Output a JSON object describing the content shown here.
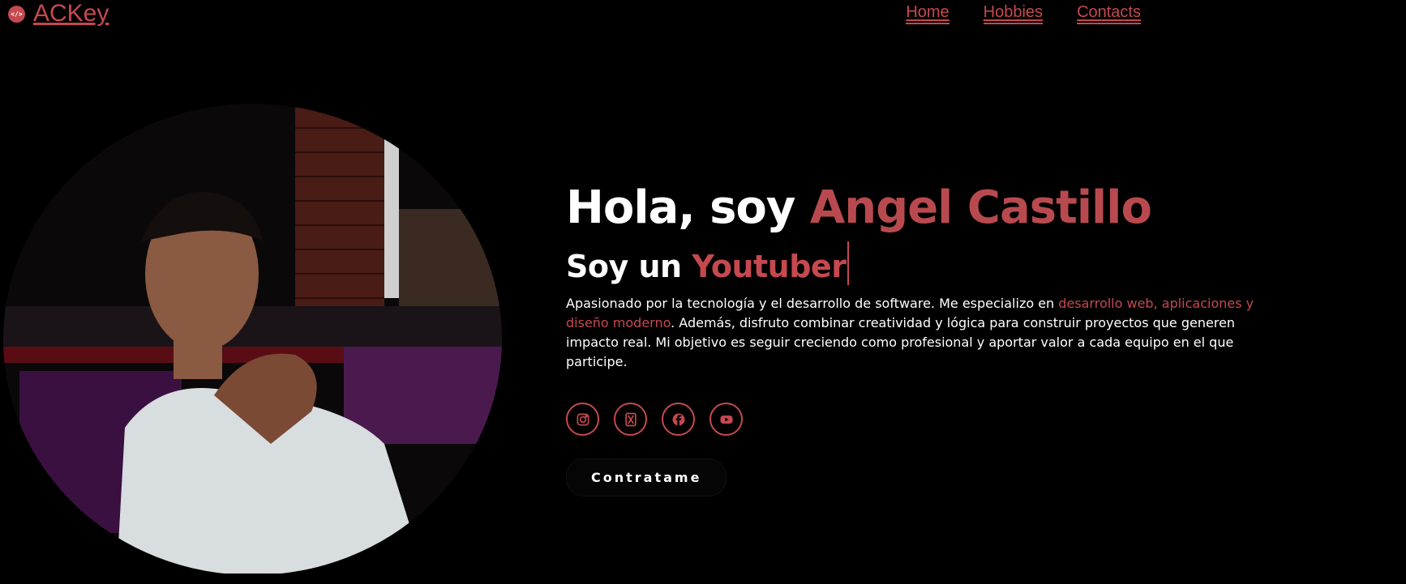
{
  "brand": {
    "name": "ACKey",
    "logo_icon": "code-icon",
    "logo_glyph": "</>"
  },
  "nav": {
    "items": [
      "Home",
      "Hobbies",
      "Contacts"
    ]
  },
  "hero": {
    "greeting_prefix": "Hola, soy ",
    "name": "Angel Castillo",
    "role_prefix": "Soy un ",
    "role": "Youtuber",
    "bio_before": "Apasionado por la tecnología y el desarrollo de software. Me especializo en ",
    "bio_highlight": "desarrollo web, aplicaciones y diseño moderno",
    "bio_after": ". Además, disfruto combinar creatividad y lógica para construir proyectos que generen impacto real. Mi objetivo es seguir creciendo como profesional y aportar valor a cada equipo en el que participe.",
    "cta_label": "Contratame"
  },
  "socials": [
    "instagram-icon",
    "x-twitter-icon",
    "facebook-icon",
    "youtube-icon"
  ],
  "colors": {
    "accent": "#c5494f",
    "background": "#000000",
    "text": "#ffffff"
  }
}
